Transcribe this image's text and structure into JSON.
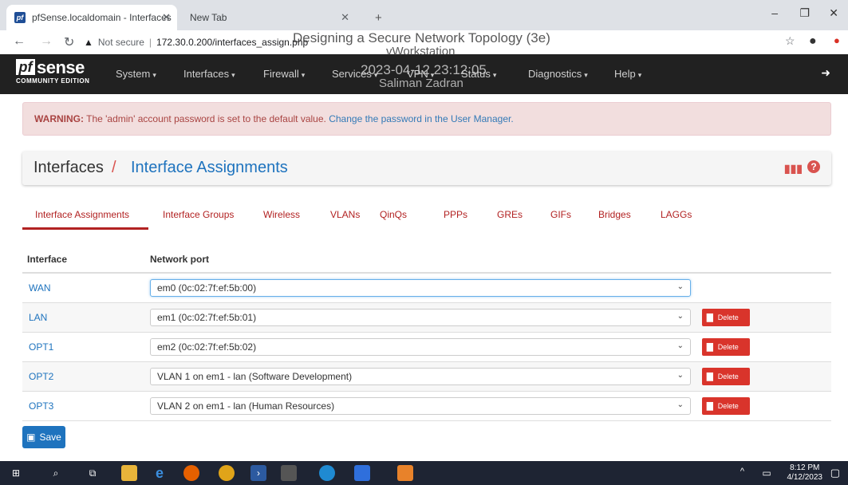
{
  "browser": {
    "tabs": [
      {
        "label": "pfSense.localdomain - Interfaces"
      },
      {
        "label": "New Tab"
      }
    ],
    "url_warning": "Not secure",
    "url": "172.30.0.200/interfaces_assign.php"
  },
  "watermark": {
    "line1": "Designing a Secure Network Topology (3e)",
    "line2": "vWorkstation",
    "line3": "2023-04-12 23:12:05",
    "line4": "Saliman Zadran"
  },
  "navbar": {
    "logo_main": "sense",
    "logo_pf": "pf",
    "logo_sub": "COMMUNITY EDITION",
    "items": [
      {
        "label": "System"
      },
      {
        "label": "Interfaces"
      },
      {
        "label": "Firewall"
      },
      {
        "label": "Services"
      },
      {
        "label": "VPN"
      },
      {
        "label": "Status"
      },
      {
        "label": "Diagnostics"
      },
      {
        "label": "Help"
      }
    ]
  },
  "warning": {
    "bold": "WARNING:",
    "text": " The 'admin' account password is set to the default value. ",
    "link": "Change the password in the User Manager."
  },
  "breadcrumb": {
    "root": "Interfaces",
    "sep": "/",
    "current": "Interface Assignments"
  },
  "tabs": [
    {
      "label": "Interface Assignments"
    },
    {
      "label": "Interface Groups"
    },
    {
      "label": "Wireless"
    },
    {
      "label": "VLANs"
    },
    {
      "label": "QinQs"
    },
    {
      "label": "PPPs"
    },
    {
      "label": "GREs"
    },
    {
      "label": "GIFs"
    },
    {
      "label": "Bridges"
    },
    {
      "label": "LAGGs"
    }
  ],
  "table": {
    "headers": [
      "Interface",
      "Network port"
    ],
    "rows": [
      {
        "interface": "WAN",
        "port": "em0 (0c:02:7f:ef:5b:00)",
        "delete": ""
      },
      {
        "interface": "LAN",
        "port": "em1 (0c:02:7f:ef:5b:01)",
        "delete": "Delete"
      },
      {
        "interface": "OPT1",
        "port": "em2 (0c:02:7f:ef:5b:02)",
        "delete": "Delete"
      },
      {
        "interface": "OPT2",
        "port": "VLAN 1 on em1 - lan (Software Development)",
        "delete": "Delete"
      },
      {
        "interface": "OPT3",
        "port": "VLAN 2 on em1 - lan (Human Resources)",
        "delete": "Delete"
      }
    ]
  },
  "save_label": "Save",
  "taskbar": {
    "time": "8:12 PM",
    "date": "4/12/2023"
  },
  "colors": {
    "accent": "#1e73be",
    "danger": "#d9342b",
    "tab_active": "#b22222",
    "navbar": "#212121"
  }
}
